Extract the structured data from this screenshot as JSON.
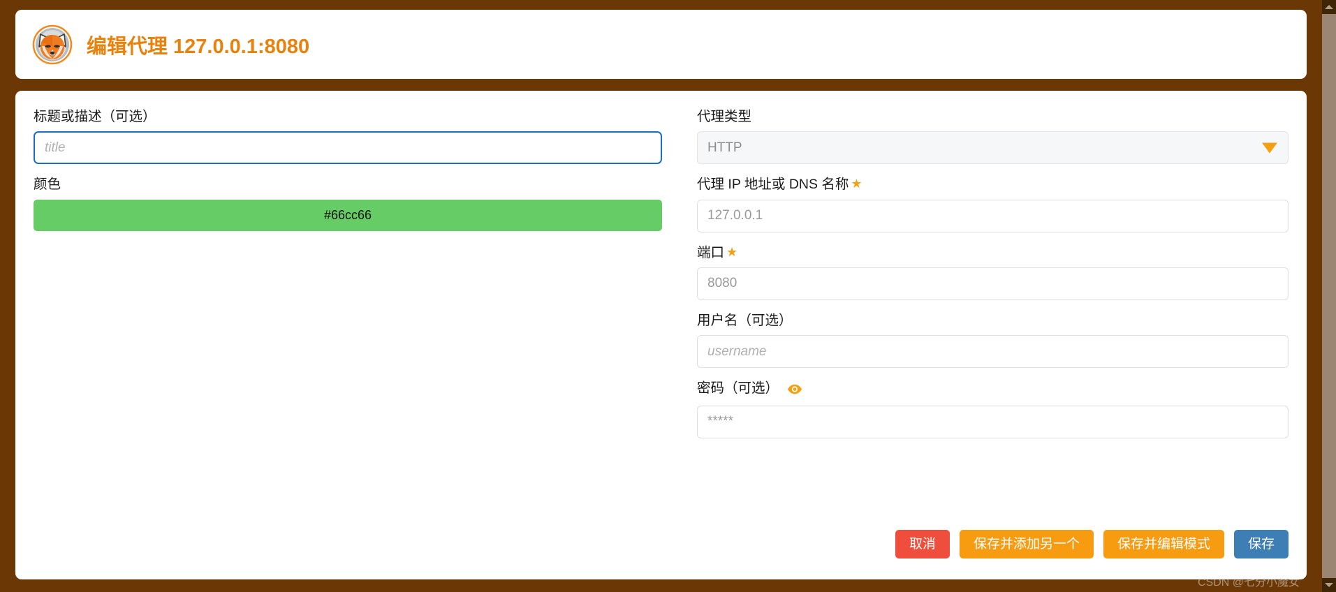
{
  "header": {
    "logo_alt": "foxyproxy-fox-logo",
    "title": "编辑代理",
    "address": "127.0.0.1:8080"
  },
  "left_column": {
    "title_field": {
      "label": "标题或描述（可选）",
      "placeholder": "title",
      "value": ""
    },
    "color_field": {
      "label": "颜色",
      "swatch_text": "#66cc66",
      "swatch_color": "#66cc66"
    }
  },
  "right_column": {
    "proxy_type": {
      "label": "代理类型",
      "selected": "HTTP"
    },
    "host": {
      "label": "代理 IP 地址或 DNS 名称",
      "required_marker": "★",
      "placeholder": "127.0.0.1",
      "value": ""
    },
    "port": {
      "label": "端口",
      "required_marker": "★",
      "placeholder": "8080",
      "value": ""
    },
    "username": {
      "label": "用户名（可选）",
      "placeholder": "username",
      "value": ""
    },
    "password": {
      "label": "密码（可选）",
      "toggle_icon": "eye-icon",
      "placeholder": "*****",
      "value": ""
    }
  },
  "buttons": {
    "cancel": "取消",
    "save_and_add_another": "保存并添加另一个",
    "save_and_edit_patterns": "保存并编辑模式",
    "save": "保存"
  },
  "watermark": "CSDN @七分小魔女",
  "colors": {
    "background_brown": "#6b3805",
    "accent_orange": "#e8820c",
    "star_orange": "#f5a012",
    "cancel_red": "#ee4e3b",
    "orange_button": "#f79b10",
    "save_blue": "#3d7fb5",
    "focus_blue": "#1a6fc4",
    "swatch_green": "#66cc66"
  }
}
